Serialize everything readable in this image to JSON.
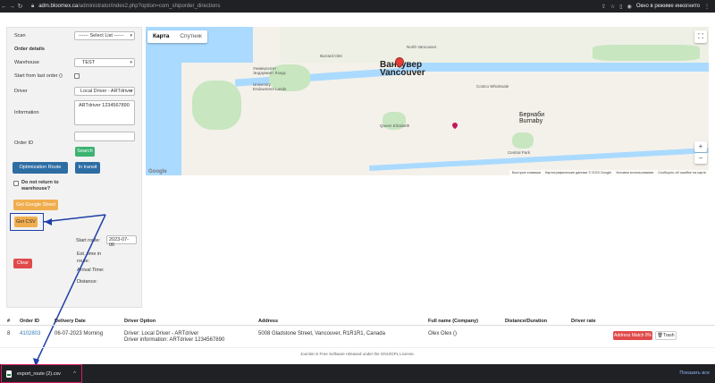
{
  "browser": {
    "url_host": "adm.bloomex.ca",
    "url_path": "/administrator/index2.php?option=com_shiporder_directions",
    "incognito_label": "Окно в режиме инкогнито"
  },
  "form": {
    "scan_label": "Scan",
    "scan_select": "------ Select List ------",
    "order_details_heading": "Order details",
    "warehouse_label": "Warehouse",
    "warehouse_value": "TEST",
    "start_from_last_label": "Start from last order ()",
    "driver_label": "Driver",
    "driver_value": "Local Driver - ARTdriver",
    "information_label": "Information",
    "information_value": "ARTdriver 1234567890",
    "order_id_label": "Order ID",
    "order_id_value": "",
    "search_button": "Search",
    "optimization_button": "Optimization Route",
    "in_transit_button": "In transit",
    "do_not_return_label": "Do not return to warehouse?",
    "google_sheet_button": "Get Google Sheet",
    "csv_button": "Get CSV",
    "start_route_label": "Start route:",
    "start_route_value": "2023-07-06",
    "est_time_label": "Est. time in route:",
    "clear_button": "Clear",
    "arrival_label": "Arrival Time:",
    "distance_label": "Distance:"
  },
  "map": {
    "tab_map": "Карта",
    "tab_satellite": "Спутник",
    "fullscreen_icon": "fullscreen-icon",
    "zoom_in": "+",
    "zoom_out": "−",
    "city_ru": "Ванкувер",
    "city_en": "Vancouver",
    "burnaby_ru": "Бернаби",
    "burnaby_en": "Burnaby",
    "labels": {
      "north_van": "North Vancouver",
      "university": "Университет Эндаумент Лэндс",
      "university_en": "University Endowment Lands",
      "costco": "Costco Wholesale",
      "queen_elizabeth": "Queen Elizabeth",
      "central_park": "Central Park",
      "burrard": "Burrard Inlet"
    },
    "footer_items": [
      "Быстрые клавиши",
      "Картографические данные © 2023 Google",
      "Условия использования",
      "Сообщить об ошибке на карте"
    ],
    "google_logo": "Google"
  },
  "table": {
    "headers": [
      "#",
      "Order ID",
      "Delivery Date",
      "Driver Option",
      "Address",
      "Full name (Company)",
      "Distance/Duration",
      "Driver rate"
    ],
    "rows": [
      {
        "num": "8",
        "order_id": "4102803",
        "delivery_date": "06-07-2023 Morning",
        "driver_line1": "Driver: Local Driver - ARTdriver",
        "driver_line2": "Driver information: ARTdriver 1234567890",
        "address": "5008 Gladstone Street, Vancouver, R1R1R1, Canada",
        "full_name": "Olex Olex ()",
        "distance": "",
        "driver_rate": "",
        "address_match": "Address Match 0%",
        "trash": "Trash"
      }
    ]
  },
  "footer_text": "Joomla! is Free Software released under the GNU/GPL License.",
  "downloads": {
    "file": "export_route (2).csv",
    "show_all": "Показать все"
  },
  "colors": {
    "accent_blue": "#2e6da4",
    "green": "#3cb371",
    "orange": "#f0ad4e",
    "red": "#e04a4a",
    "highlight": "#1e3fa8",
    "download_highlight": "#d81b60"
  }
}
